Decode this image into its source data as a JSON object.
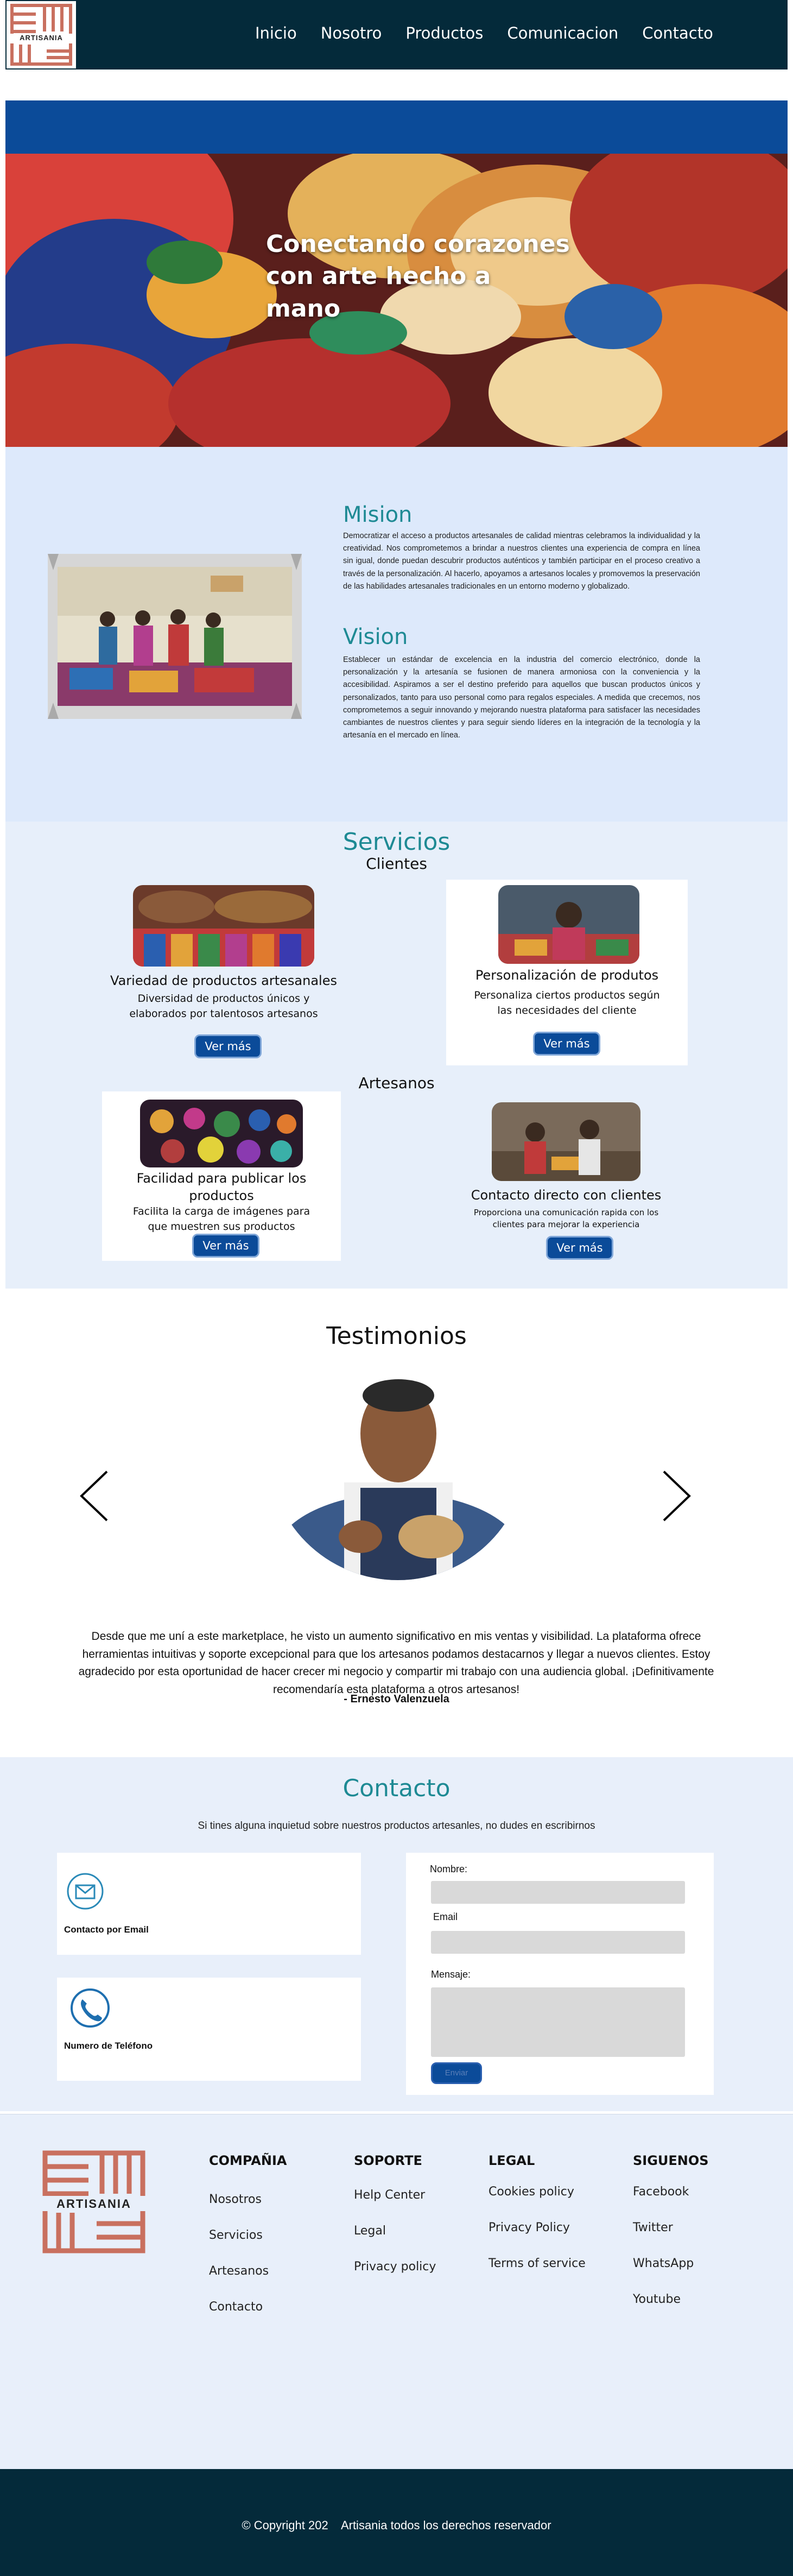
{
  "brand": {
    "name": "ARTISANIA"
  },
  "nav": {
    "items": [
      "Inicio",
      "Nosotro",
      "Productos",
      "Comunicacion",
      "Contacto"
    ]
  },
  "hero": {
    "title": "Conectando corazones\ncon arte hecho a mano"
  },
  "mission": {
    "title": "Mision",
    "text": "Democratizar el acceso a productos artesanales de calidad mientras celebramos la individualidad y la creatividad. Nos comprometemos a brindar a nuestros clientes una experiencia de compra en línea sin igual, donde puedan descubrir productos auténticos y también participar en el proceso creativo a través de la personalización. Al hacerlo, apoyamos a artesanos locales y promovemos la preservación de las habilidades artesanales tradicionales en un entorno moderno y globalizado."
  },
  "vision": {
    "title": "Vision",
    "text": "Establecer un estándar de excelencia en la industria del comercio electrónico, donde la personalización y la artesanía se fusionen de manera armoniosa con la conveniencia y la accesibilidad. Aspiramos a ser el destino preferido para aquellos que buscan productos únicos y personalizados, tanto para uso personal como para regalos especiales. A medida que crecemos, nos comprometemos a seguir innovando y mejorando nuestra plataforma para satisfacer las necesidades cambiantes de nuestros clientes y para seguir siendo líderes en la integración de la tecnología y la artesanía en el mercado en línea."
  },
  "services": {
    "title": "Servicios",
    "clients_label": "Clientes",
    "artisans_label": "Artesanos",
    "cards": [
      {
        "title": "Variedad de productos artesanales",
        "desc": "Diversidad de productos únicos y elaborados por talentosos artesanos",
        "button": "Ver más"
      },
      {
        "title": "Personalización de produtos",
        "desc": "Personaliza ciertos productos según las necesidades del cliente",
        "button": "Ver más"
      },
      {
        "title": "Facilidad para publicar los productos",
        "desc": "Facilita la carga de imágenes para que muestren sus productos",
        "button": "Ver más"
      },
      {
        "title": "Contacto directo con clientes",
        "desc": "Proporciona una comunicación rapida con los clientes para mejorar la experiencia",
        "button": "Ver más"
      }
    ]
  },
  "testimonials": {
    "title": "Testimonios",
    "quote": "Desde que me uní a este marketplace, he visto un aumento significativo en mis ventas y visibilidad. La plataforma ofrece herramientas intuitivas y soporte excepcional para que los artesanos podamos destacarnos y llegar a nuevos clientes. Estoy agradecido por esta oportunidad de hacer crecer mi negocio y compartir mi trabajo con una audiencia global. ¡Definitivamente recomendaría esta plataforma a otros artesanos!",
    "author": "- Ernesto Valenzuela"
  },
  "contact": {
    "title": "Contacto",
    "subtitle": "Si tines alguna inquietud sobre nuestros productos artesanles, no dudes en escribirnos",
    "email_label": "Contacto por Email",
    "phone_label": "Numero de Teléfono",
    "form": {
      "name_label": "Nombre:",
      "email_label": "Email",
      "message_label": "Mensaje:",
      "send_label": "Enviar"
    }
  },
  "footer": {
    "columns": [
      {
        "title": "COMPAÑIA",
        "links": [
          "Nosotros",
          "Servicios",
          "Artesanos",
          "Contacto"
        ]
      },
      {
        "title": "SOPORTE",
        "links": [
          "Help Center",
          "Legal",
          "Privacy policy"
        ]
      },
      {
        "title": "LEGAL",
        "links": [
          "Cookies policy",
          "Privacy Policy",
          "Terms of service"
        ]
      },
      {
        "title": "SIGUENOS",
        "links": [
          "Facebook",
          "Twitter",
          "WhatsApp",
          "Youtube"
        ]
      }
    ],
    "copyright": "© Copyright 202    Artisania todos los derechos reservador"
  },
  "colors": {
    "navy": "#042a3a",
    "blue": "#0b4b99",
    "teal": "#1e8a94",
    "light": "#e8effa",
    "logo": "#c9705f"
  }
}
